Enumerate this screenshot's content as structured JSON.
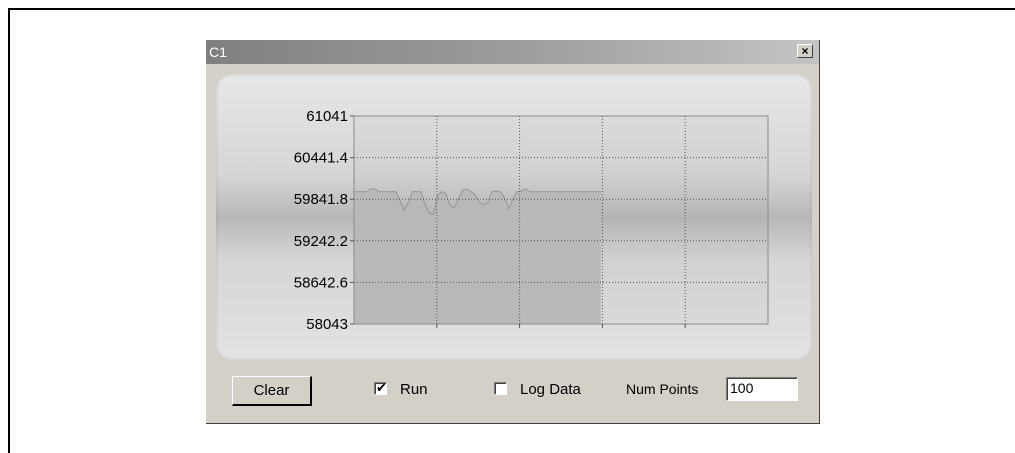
{
  "window": {
    "title": "C1",
    "close_glyph": "×"
  },
  "controls": {
    "clear_label": "Clear",
    "run_label": "Run",
    "run_checked": true,
    "logdata_label": "Log Data",
    "logdata_checked": false,
    "numpoints_label": "Num Points",
    "numpoints_value": "100"
  },
  "chart_data": {
    "type": "area",
    "ylim": [
      58043,
      61041
    ],
    "yticks": [
      "61041",
      "60441.4",
      "59841.8",
      "59242.2",
      "58642.6",
      "58043"
    ],
    "x_capacity": 100,
    "grid": true,
    "fill_color": "#b9b9b9",
    "values": [
      59950,
      59950,
      59950,
      59950,
      59990,
      59990,
      59950,
      59950,
      59950,
      59950,
      59950,
      59820,
      59680,
      59800,
      59950,
      59950,
      59950,
      59760,
      59640,
      59620,
      59900,
      59950,
      59920,
      59750,
      59720,
      59850,
      59970,
      59990,
      59950,
      59900,
      59800,
      59760,
      59800,
      59950,
      59960,
      59950,
      59860,
      59700,
      59840,
      59950,
      59960,
      59990,
      59950,
      59950,
      59950,
      59950,
      59950,
      59950,
      59950,
      59950,
      59950,
      59950,
      59950,
      59950,
      59950,
      59950,
      59950,
      59950,
      59950,
      59950
    ]
  }
}
